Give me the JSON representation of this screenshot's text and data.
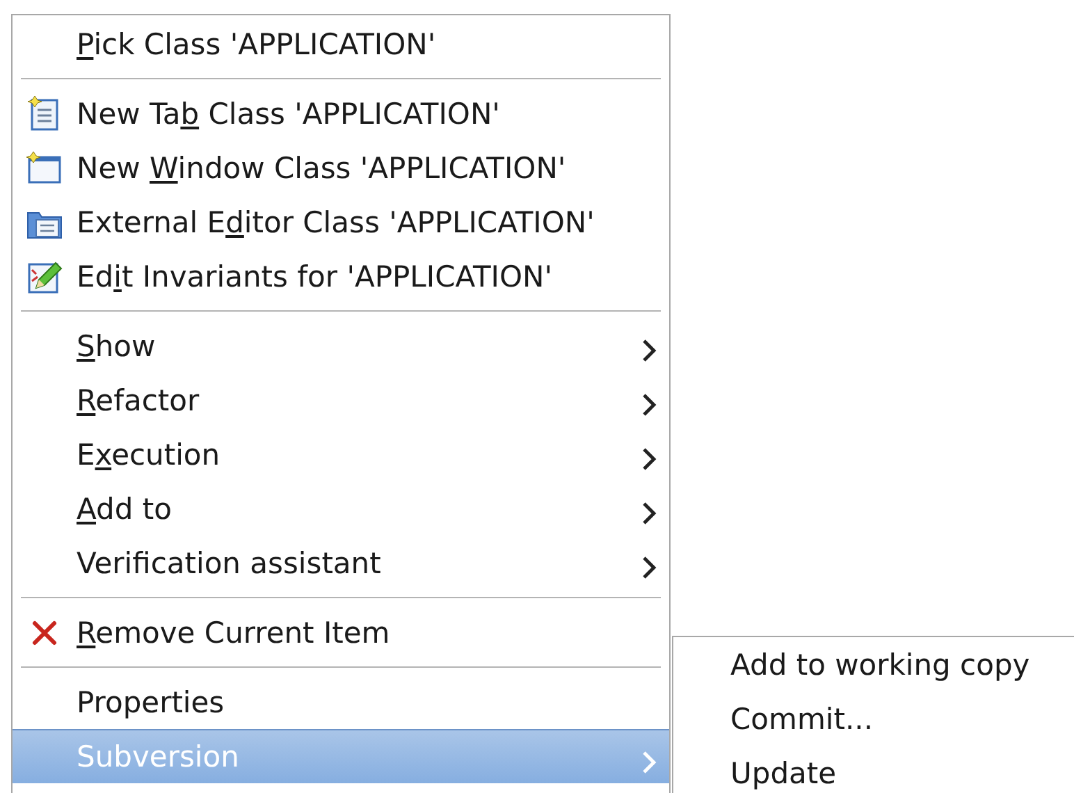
{
  "menu": {
    "items": [
      {
        "kind": "item",
        "key": "P",
        "post": "ick Class 'APPLICATION'",
        "has_submenu": false,
        "selected": false
      },
      {
        "kind": "separator"
      },
      {
        "kind": "item",
        "pre": "New Ta",
        "key": "b",
        "post": " Class 'APPLICATION'",
        "has_submenu": false,
        "selected": false
      },
      {
        "kind": "item",
        "pre": "New ",
        "key": "W",
        "post": "indow Class 'APPLICATION'",
        "has_submenu": false,
        "selected": false
      },
      {
        "kind": "item",
        "pre": "External E",
        "key": "d",
        "post": "itor Class 'APPLICATION'",
        "has_submenu": false,
        "selected": false
      },
      {
        "kind": "item",
        "pre": "Ed",
        "key": "i",
        "post": "t Invariants for 'APPLICATION'",
        "has_submenu": false,
        "selected": false
      },
      {
        "kind": "separator"
      },
      {
        "kind": "item",
        "key": "S",
        "post": "how",
        "has_submenu": true,
        "selected": false
      },
      {
        "kind": "item",
        "key": "R",
        "post": "efactor",
        "has_submenu": true,
        "selected": false
      },
      {
        "kind": "item",
        "pre": "E",
        "key": "x",
        "post": "ecution",
        "has_submenu": true,
        "selected": false
      },
      {
        "kind": "item",
        "key": "A",
        "post": "dd to",
        "has_submenu": true,
        "selected": false
      },
      {
        "kind": "item",
        "pre": "Verification assistant",
        "has_submenu": true,
        "selected": false
      },
      {
        "kind": "separator"
      },
      {
        "kind": "item",
        "key": "R",
        "post": "emove Current Item",
        "has_submenu": false,
        "selected": false
      },
      {
        "kind": "separator"
      },
      {
        "kind": "item",
        "pre": "Properties",
        "has_submenu": false,
        "selected": false
      },
      {
        "kind": "item",
        "pre": "Subversion",
        "has_submenu": true,
        "selected": true
      }
    ]
  },
  "submenu": {
    "items": [
      {
        "label": "Add to working copy",
        "selected": false
      },
      {
        "label": "Commit...",
        "selected": false
      },
      {
        "label": "Update",
        "selected": false
      }
    ]
  }
}
